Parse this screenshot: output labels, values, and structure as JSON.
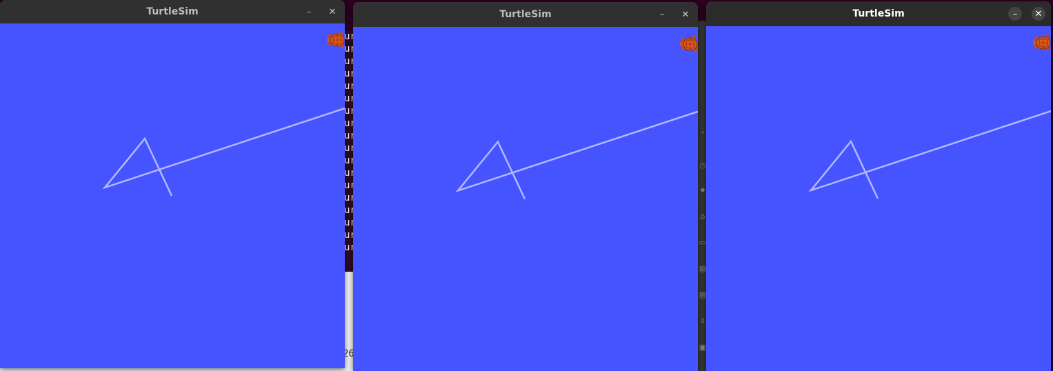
{
  "colors": {
    "canvas_bg": "#4554ff",
    "pen": "#b3b8ff",
    "titlebar": "#303030",
    "desktop": "#2c001e"
  },
  "background": {
    "terminal_lines": [
      "ur",
      "ur",
      "ur",
      "ur",
      "ur",
      "ur",
      "ur",
      "ur",
      "ur",
      "ur",
      "ur",
      "ur",
      "ur",
      "ur",
      "ur",
      "ur",
      "ur",
      "ur"
    ],
    "panel_text": "26",
    "sidebar_icons": [
      "chevron-left-icon",
      "clock-icon",
      "star-icon",
      "home-icon",
      "folder-icon",
      "document-icon",
      "download-icon",
      "picture-icon"
    ]
  },
  "windows": [
    {
      "title": "TurtleSim",
      "minimize_label": "–",
      "close_label": "✕",
      "active": false
    },
    {
      "title": "TurtleSim",
      "minimize_label": "–",
      "close_label": "✕",
      "active": false
    },
    {
      "title": "TurtleSim",
      "minimize_label": "–",
      "close_label": "✕",
      "active": true
    }
  ]
}
